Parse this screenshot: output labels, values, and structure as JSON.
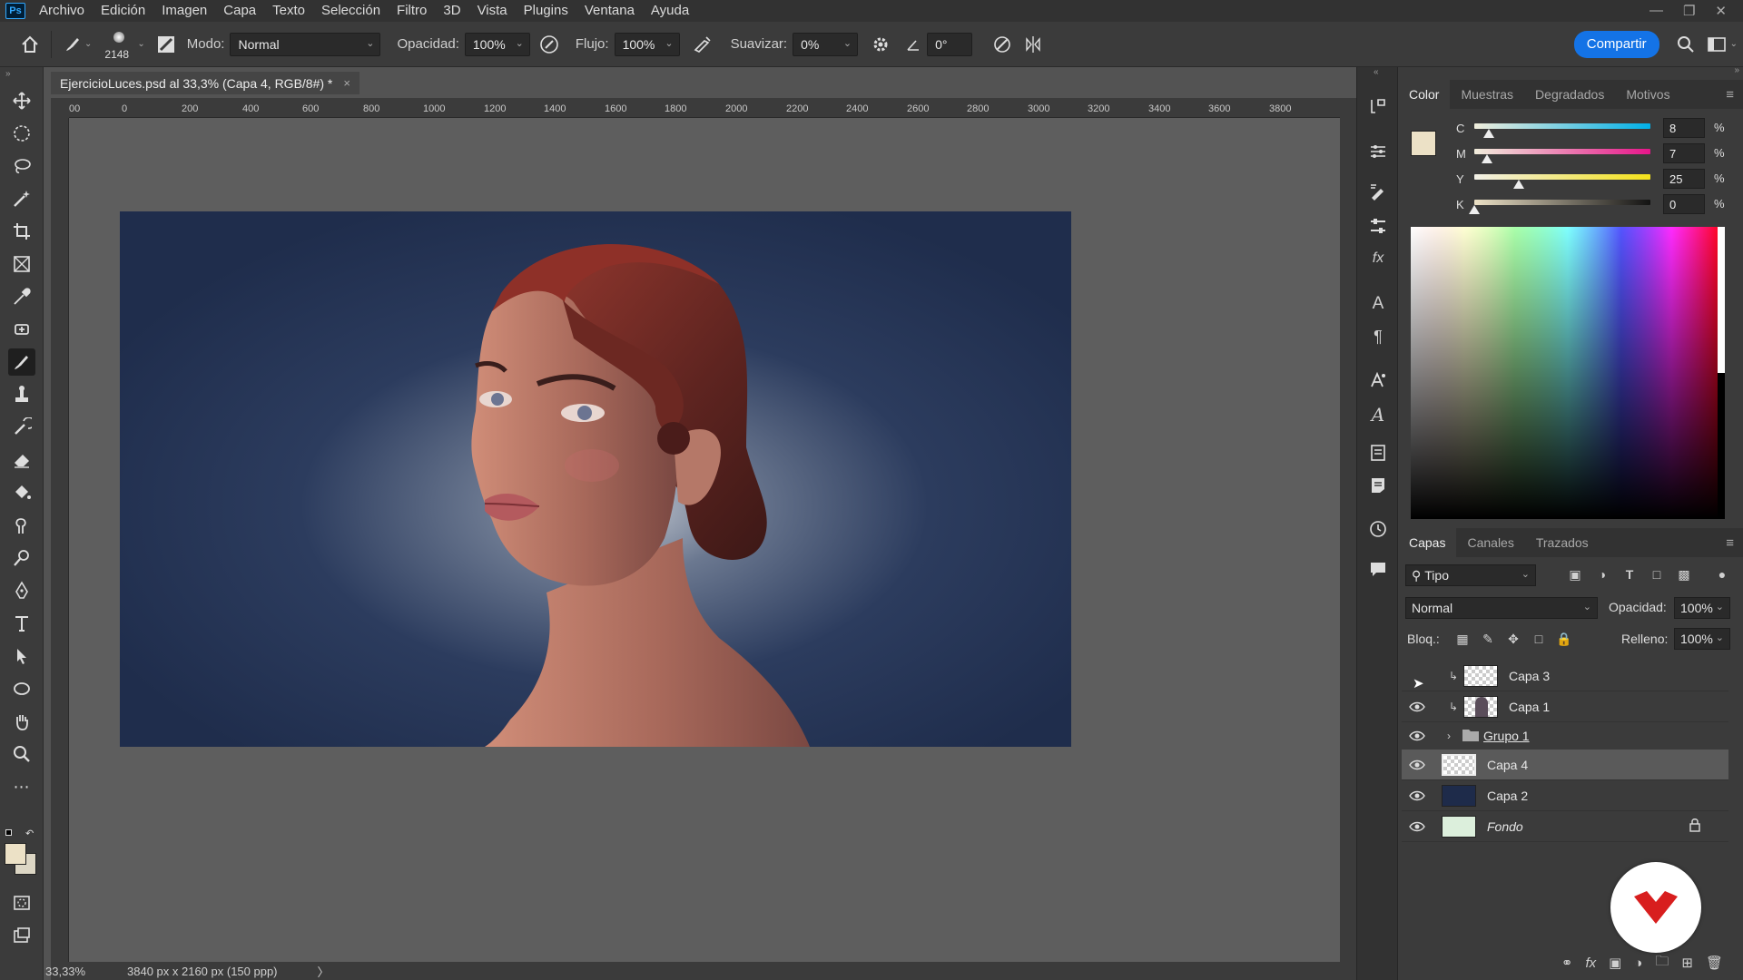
{
  "menubar": {
    "logo": "Ps",
    "items": [
      "Archivo",
      "Edición",
      "Imagen",
      "Capa",
      "Texto",
      "Selección",
      "Filtro",
      "3D",
      "Vista",
      "Plugins",
      "Ventana",
      "Ayuda"
    ]
  },
  "options": {
    "brush_size": "2148",
    "mode_label": "Modo:",
    "mode_value": "Normal",
    "opacity_label": "Opacidad:",
    "opacity_value": "100%",
    "flow_label": "Flujo:",
    "flow_value": "100%",
    "smooth_label": "Suavizar:",
    "smooth_value": "0%",
    "angle_value": "0°",
    "share_label": "Compartir"
  },
  "document": {
    "tab_title": "EjercicioLuces.psd al 33,3% (Capa 4, RGB/8#) *",
    "close_glyph": "×",
    "ruler_ticks": [
      "00",
      "0",
      "200",
      "400",
      "600",
      "800",
      "1000",
      "1200",
      "1400",
      "1600",
      "1800",
      "2000",
      "2200",
      "2400",
      "2600",
      "2800",
      "3000",
      "3200",
      "3400",
      "3600",
      "3800"
    ],
    "zoom": "33,33%",
    "dimensions": "3840 px x 2160 px (150 ppp)",
    "status_arrow": "〉"
  },
  "color_panel": {
    "tabs": [
      "Color",
      "Muestras",
      "Degradados",
      "Motivos"
    ],
    "active_tab": "Color",
    "foreground_color": "#ece1c6",
    "channels": [
      {
        "label": "C",
        "value": "8",
        "fraction": 0.08
      },
      {
        "label": "M",
        "value": "7",
        "fraction": 0.07
      },
      {
        "label": "Y",
        "value": "25",
        "fraction": 0.25
      },
      {
        "label": "K",
        "value": "0",
        "fraction": 0.0
      }
    ],
    "percent_sign": "%"
  },
  "layers_panel": {
    "tabs": [
      "Capas",
      "Canales",
      "Trazados"
    ],
    "active_tab": "Capas",
    "filter_label": "Tipo",
    "blend_mode": "Normal",
    "opacity_label": "Opacidad:",
    "opacity_value": "100%",
    "lock_label": "Bloq.:",
    "fill_label": "Relleno:",
    "fill_value": "100%",
    "layers": [
      {
        "name": "Capa 3",
        "visible": false,
        "clipped": true
      },
      {
        "name": "Capa 1",
        "visible": true,
        "clipped": true
      },
      {
        "name": "Grupo 1",
        "visible": true,
        "group": true
      },
      {
        "name": "Capa 4",
        "visible": true,
        "selected": true
      },
      {
        "name": "Capa 2",
        "visible": true
      },
      {
        "name": "Fondo",
        "visible": true,
        "locked": true
      }
    ]
  },
  "colors": {
    "accent": "#1473e6",
    "canvas_bg": "#22304f",
    "hair": "#6a2a24",
    "skin": "#b57868",
    "badge_red": "#d81e1e"
  }
}
